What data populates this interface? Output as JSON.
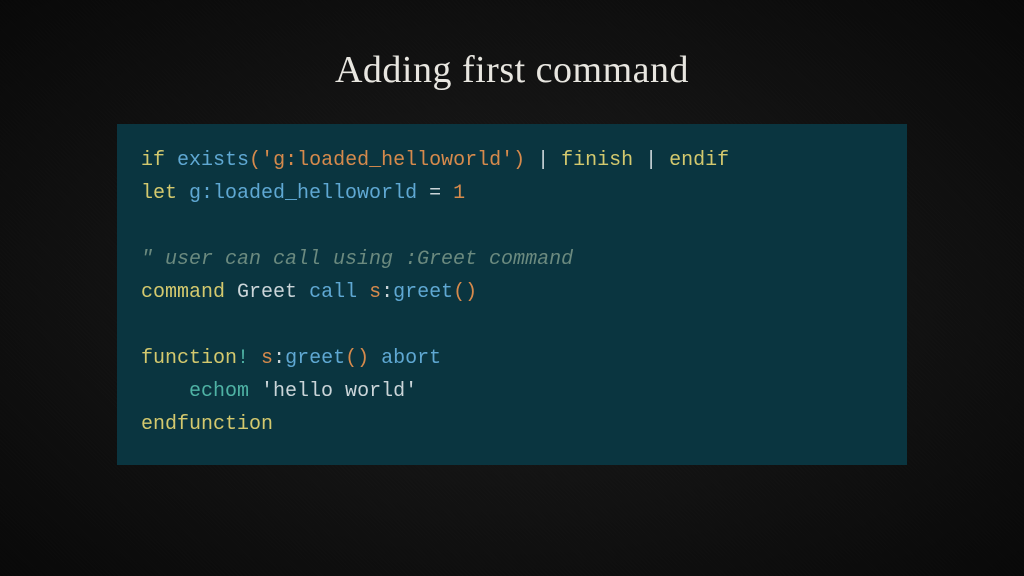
{
  "title": "Adding first command",
  "code": {
    "l1": {
      "a": "if",
      "b": "exists",
      "c": "(",
      "d": "'g:loaded_helloworld'",
      "e": ")",
      "f": " | ",
      "g": "finish",
      "h": " | ",
      "i": "endif"
    },
    "l2": {
      "a": "let",
      "b": "g:loaded_helloworld",
      "c": " = ",
      "d": "1"
    },
    "l3": "",
    "l4": {
      "a": "\" user can call using :Greet command"
    },
    "l5": {
      "a": "command",
      "b": "Greet",
      "c": "call",
      "d": "s",
      "e": ":",
      "f": "greet",
      "g": "()"
    },
    "l6": "",
    "l7": {
      "a": "function",
      "b": "!",
      "c": "s",
      "d": ":",
      "e": "greet",
      "f": "()",
      "g": "abort"
    },
    "l8": {
      "a": "    ",
      "b": "echom",
      "c": "'hello world'"
    },
    "l9": {
      "a": "endfunction"
    }
  }
}
